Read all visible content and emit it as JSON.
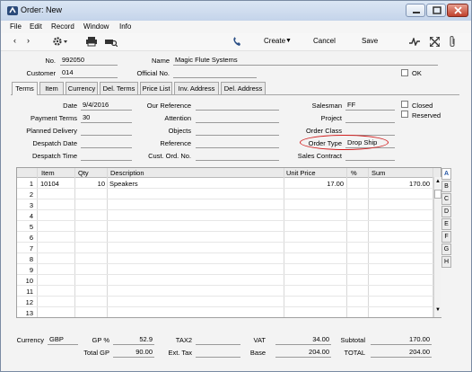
{
  "window": {
    "title": "Order: New"
  },
  "menu": [
    "File",
    "Edit",
    "Record",
    "Window",
    "Info"
  ],
  "toolbar": {
    "create": "Create",
    "cancel": "Cancel",
    "save": "Save"
  },
  "header": {
    "no_label": "No.",
    "no_value": "992050",
    "name_label": "Name",
    "name_value": "Magic Flute Systems",
    "customer_label": "Customer",
    "customer_value": "014",
    "official_label": "Official No.",
    "official_value": "",
    "ok_label": "OK"
  },
  "tabs": [
    "Terms",
    "Item",
    "Currency",
    "Del. Terms",
    "Price List",
    "Inv. Address",
    "Del. Address"
  ],
  "terms": {
    "date_label": "Date",
    "date_value": "9/4/2016",
    "payterms_label": "Payment Terms",
    "payterms_value": "30",
    "planned_label": "Planned Delivery",
    "planned_value": "",
    "despdate_label": "Despatch Date",
    "despdate_value": "",
    "desptime_label": "Despatch Time",
    "desptime_value": "",
    "ourref_label": "Our Reference",
    "ourref_value": "",
    "attention_label": "Attention",
    "attention_value": "",
    "objects_label": "Objects",
    "objects_value": "",
    "reference_label": "Reference",
    "reference_value": "",
    "custord_label": "Cust. Ord. No.",
    "custord_value": "",
    "salesman_label": "Salesman",
    "salesman_value": "FF",
    "project_label": "Project",
    "project_value": "",
    "orderclass_label": "Order Class",
    "orderclass_value": "",
    "ordertype_label": "Order Type",
    "ordertype_value": "Drop Ship",
    "salescontract_label": "Sales Contract",
    "salescontract_value": "",
    "closed_label": "Closed",
    "reserved_label": "Reserved"
  },
  "grid": {
    "columns": [
      "Item",
      "Qty",
      "Description",
      "Unit Price",
      "%",
      "Sum"
    ],
    "rows": [
      {
        "n": "1",
        "item": "10104",
        "qty": "10",
        "desc": "Speakers",
        "price": "17.00",
        "pct": "",
        "sum": "170.00"
      },
      {
        "n": "2"
      },
      {
        "n": "3"
      },
      {
        "n": "4"
      },
      {
        "n": "5"
      },
      {
        "n": "6"
      },
      {
        "n": "7"
      },
      {
        "n": "8"
      },
      {
        "n": "9"
      },
      {
        "n": "10"
      },
      {
        "n": "11"
      },
      {
        "n": "12"
      },
      {
        "n": "13"
      }
    ],
    "side_tabs": [
      "A",
      "B",
      "C",
      "D",
      "E",
      "F",
      "G",
      "H"
    ]
  },
  "footer": {
    "currency_label": "Currency",
    "currency_value": "GBP",
    "gp_label": "GP %",
    "gp_value": "52.9",
    "totalgp_label": "Total GP",
    "totalgp_value": "90.00",
    "tax2_label": "TAX2",
    "tax2_value": "",
    "exttax_label": "Ext. Tax",
    "exttax_value": "",
    "vat_label": "VAT",
    "vat_value": "34.00",
    "base_label": "Base",
    "base_value": "204.00",
    "subtotal_label": "Subtotal",
    "subtotal_value": "170.00",
    "total_label": "TOTAL",
    "total_value": "204.00"
  }
}
